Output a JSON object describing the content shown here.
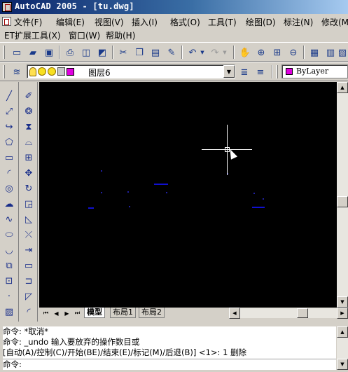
{
  "window": {
    "title": "AutoCAD 2005 - [tu.dwg]"
  },
  "menu": {
    "row1": [
      "文件(F)",
      "编辑(E)",
      "视图(V)",
      "插入(I)",
      "格式(O)",
      "工具(T)",
      "绘图(D)",
      "标注(N)",
      "修改(M)"
    ],
    "row2": [
      "ET扩展工具(X)",
      "窗口(W)",
      "帮助(H)"
    ]
  },
  "layers": {
    "current_layer": "图层6",
    "current_color": "ByLayer",
    "layer_color": "#e000e0"
  },
  "toolbar_standard": {
    "icons": [
      "new-icon",
      "open-icon",
      "save-icon",
      "plot-icon",
      "plot-preview-icon",
      "publish-icon",
      "cut-icon",
      "copy-icon",
      "paste-icon",
      "match-properties-icon",
      "undo-icon",
      "redo-icon",
      "pan-icon",
      "zoom-realtime-icon",
      "zoom-window-icon",
      "zoom-previous-icon",
      "properties-icon",
      "design-center-icon"
    ]
  },
  "palette_draw": {
    "icons": [
      "line-icon",
      "construction-line-icon",
      "polyline-icon",
      "polygon-icon",
      "rectangle-icon",
      "arc-icon",
      "circle-icon",
      "revision-cloud-icon",
      "spline-icon",
      "ellipse-icon",
      "ellipse-arc-icon",
      "insert-block-icon",
      "make-block-icon",
      "point-icon",
      "hatch-icon"
    ]
  },
  "palette_modify": {
    "icons": [
      "erase-icon",
      "copy-object-icon",
      "mirror-icon",
      "offset-icon",
      "array-icon",
      "move-icon",
      "rotate-icon",
      "scale-icon",
      "stretch-icon",
      "trim-icon",
      "extend-icon",
      "break-icon",
      "join-icon",
      "chamfer-icon",
      "fillet-icon"
    ]
  },
  "layout_tabs": {
    "tabs": [
      "模型",
      "布局1",
      "布局2"
    ],
    "active": "模型"
  },
  "command": {
    "lines": [
      "命令: *取消*",
      "命令: _undo 输入要放弃的操作数目或",
      "[自动(A)/控制(C)/开始(BE)/结束(E)/标记(M)/后退(B)] <1>: 1 删除"
    ],
    "prompt": "命令:"
  }
}
